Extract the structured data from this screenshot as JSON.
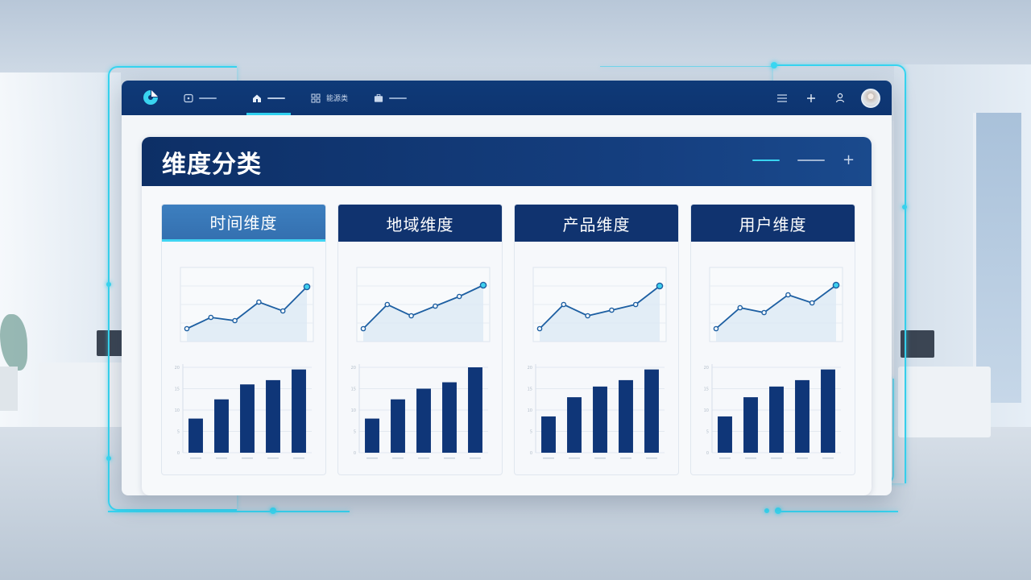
{
  "colors": {
    "accent": "#2fd0ef",
    "navy": "#10336f",
    "line": "#1d5fa2",
    "bar": "#0f3678"
  },
  "topbar": {
    "logo_icon": "logo-icon",
    "nav": [
      {
        "icon": "screen-icon",
        "label": ""
      },
      {
        "icon": "home-icon",
        "label": "",
        "active": true
      },
      {
        "icon": "grid-icon",
        "label": "能源类"
      },
      {
        "icon": "briefcase-icon",
        "label": ""
      }
    ],
    "tools": [
      "menu-icon",
      "plus-icon",
      "user-icon"
    ]
  },
  "panel": {
    "title": "维度分类"
  },
  "cards": [
    {
      "title": "时间维度",
      "active": true
    },
    {
      "title": "地域维度",
      "active": false
    },
    {
      "title": "产品维度",
      "active": false
    },
    {
      "title": "用户维度",
      "active": false
    }
  ],
  "chart_data": [
    {
      "card": "时间维度",
      "line": {
        "type": "line",
        "values": [
          1.0,
          2.4,
          2.0,
          4.3,
          3.2,
          6.2
        ],
        "ylim": [
          0,
          8
        ]
      },
      "bar": {
        "type": "bar",
        "values": [
          8,
          12.5,
          16,
          17,
          19.5
        ],
        "ylim": [
          0,
          20
        ],
        "yticks": [
          0,
          5,
          10,
          15,
          20
        ]
      }
    },
    {
      "card": "地域维度",
      "line": {
        "type": "line",
        "values": [
          1.0,
          4.0,
          2.6,
          3.8,
          5.0,
          6.4
        ],
        "ylim": [
          0,
          8
        ]
      },
      "bar": {
        "type": "bar",
        "values": [
          8,
          12.5,
          15,
          16.5,
          20
        ],
        "ylim": [
          0,
          20
        ],
        "yticks": [
          0,
          5,
          10,
          15,
          20
        ]
      }
    },
    {
      "card": "产品维度",
      "line": {
        "type": "line",
        "values": [
          1.0,
          4.0,
          2.6,
          3.3,
          4.0,
          6.3
        ],
        "ylim": [
          0,
          8
        ]
      },
      "bar": {
        "type": "bar",
        "values": [
          8.5,
          13,
          15.5,
          17,
          19.5
        ],
        "ylim": [
          0,
          20
        ],
        "yticks": [
          0,
          5,
          10,
          15,
          20
        ]
      }
    },
    {
      "card": "用户维度",
      "line": {
        "type": "line",
        "values": [
          1.0,
          3.6,
          3.0,
          5.2,
          4.2,
          6.4
        ],
        "ylim": [
          0,
          8
        ]
      },
      "bar": {
        "type": "bar",
        "values": [
          8.5,
          13,
          15.5,
          17,
          19.5
        ],
        "ylim": [
          0,
          20
        ],
        "yticks": [
          0,
          5,
          10,
          15,
          20
        ]
      }
    }
  ]
}
